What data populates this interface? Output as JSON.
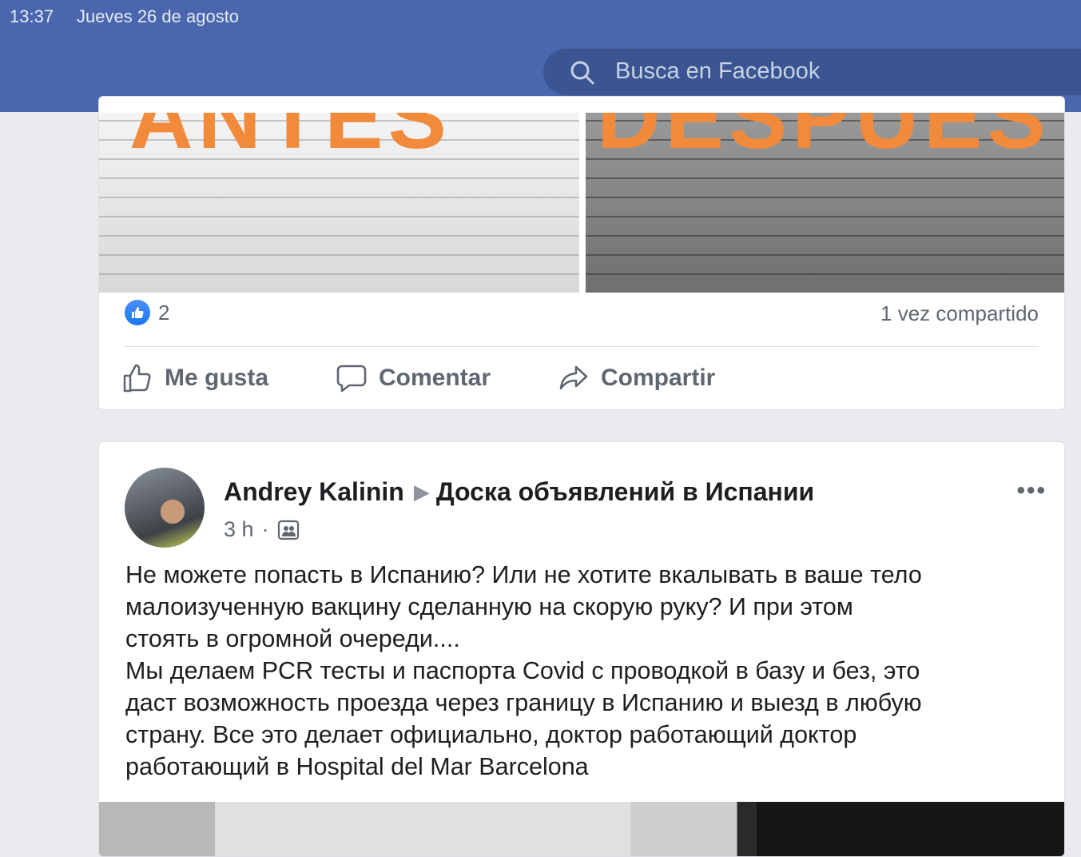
{
  "status_bar": {
    "time": "13:37",
    "date": "Jueves 26 de agosto"
  },
  "header": {
    "search_placeholder": "Busca en Facebook",
    "colors": {
      "bar": "#4a67ad",
      "search": "#3a5591"
    }
  },
  "post1": {
    "photo_left_text": "ANTES",
    "photo_right_text": "DESPUES",
    "likes_count": "2",
    "shares": "1 vez compartido",
    "actions": {
      "like": "Me gusta",
      "comment": "Comentar",
      "share": "Compartir"
    },
    "icons": [
      "like-badge-icon",
      "thumbs-up-icon",
      "comment-icon",
      "share-icon"
    ]
  },
  "post2": {
    "author": "Andrey Kalinin",
    "group": "Доска объявлений в Испании",
    "time": "3 h",
    "separator": "·",
    "more": "•••",
    "lines": [
      "Не можете попасть в Испанию? Или не хотите вкалывать в ваше тело",
      "малоизученную вакцину сделанную на скорую руку? И при этом",
      "стоять в огромной очереди....",
      "Мы делаем  PCR тесты и паспорта Covid с проводкой в базу и без, это",
      "даст возможность проезда через границу в Испанию и выезд в любую",
      "страну. Все это делает официально, доктор работающий доктор",
      "работающий в Hospital del Mar Barcelona"
    ]
  }
}
